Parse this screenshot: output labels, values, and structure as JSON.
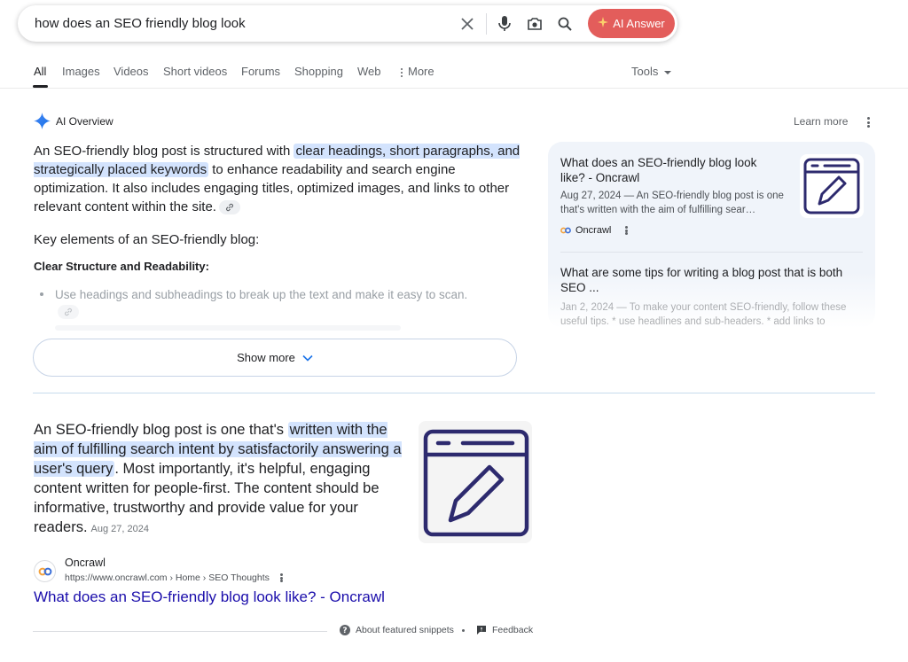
{
  "search": {
    "query": "how does an SEO friendly blog look",
    "ai_button_label": "AI Answer"
  },
  "tabs": [
    {
      "label": "All"
    },
    {
      "label": "Images"
    },
    {
      "label": "Videos"
    },
    {
      "label": "Short videos"
    },
    {
      "label": "Forums"
    },
    {
      "label": "Shopping"
    },
    {
      "label": "Web"
    },
    {
      "label": "More"
    }
  ],
  "tools_label": "Tools",
  "ai_overview": {
    "title": "AI Overview",
    "learn_more": "Learn more",
    "para_pre": "An SEO-friendly blog post is structured with ",
    "para_hl": "clear headings, short paragraphs, and strategically placed keywords",
    "para_post": " to enhance readability and search engine optimization. It also includes engaging titles, optimized images, and links to other relevant content within the site.",
    "heading_key": "Key elements of an SEO-friendly blog:",
    "heading_clear": "Clear Structure and Readability:",
    "bullet_1": "Use headings and subheadings to break up the text and make it easy to scan.",
    "show_more": "Show more"
  },
  "sources": [
    {
      "title": "What does an SEO-friendly blog look like? - Oncrawl",
      "snippet": "Aug 27, 2024 — An SEO-friendly blog post is one that's written with the aim of fulfilling sear…",
      "site": "Oncrawl"
    },
    {
      "title": "What are some tips for writing a blog post that is both SEO ...",
      "snippet": "Jan 2, 2024 — To make your content SEO-friendly, follow these useful tips. * use headlines and sub-headers. * add links to"
    }
  ],
  "featured": {
    "pre": "An SEO-friendly blog post is one that's ",
    "hl": "written with the aim of fulfilling search intent by satisfactorily answering a user's query",
    "post": ". Most importantly, it's helpful, engaging content written for people-first. The content should be informative, trustworthy and provide value for your readers.",
    "date": "Aug 27, 2024",
    "site_name": "Oncrawl",
    "site_url": "https://www.oncrawl.com › Home › SEO Thoughts",
    "link_title": "What does an SEO-friendly blog look like? - Oncrawl"
  },
  "footer": {
    "about": "About featured snippets",
    "feedback": "Feedback"
  },
  "colors": {
    "highlight": "#d3e3fd",
    "ai_button": "#e35d5b",
    "link": "#1a0dab",
    "icon_purple": "#2d2a6e"
  }
}
